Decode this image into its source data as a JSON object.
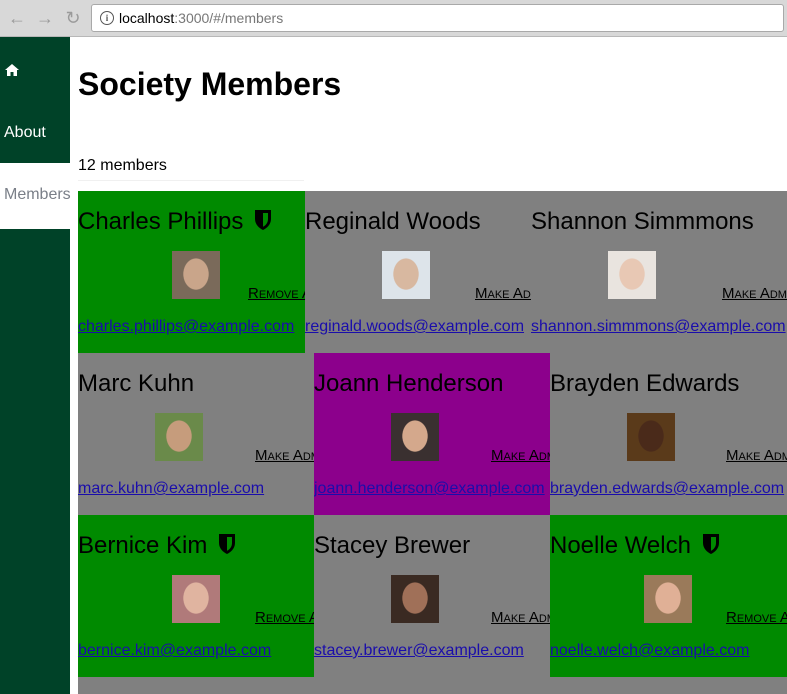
{
  "browser": {
    "url_host": "localhost",
    "url_path": ":3000/#/members"
  },
  "sidebar": {
    "home_icon": "home-icon",
    "about_label": "About",
    "members_label": "Members",
    "bg_color": "#004228"
  },
  "main": {
    "title": "Society Members",
    "member_count": "12 members"
  },
  "members": [
    {
      "name": "Charles Phillips",
      "email": "charles.phillips@example.com",
      "action": "Remove Admin",
      "admin": true
    },
    {
      "name": "Reginald Woods",
      "email": "reginald.woods@example.com",
      "action": "Make Admin",
      "admin": false
    },
    {
      "name": "Shannon Simmmons",
      "email": "shannon.simmmons@example.com",
      "action": "Make Admin",
      "admin": false
    },
    {
      "name": "Marc Kuhn",
      "email": "marc.kuhn@example.com",
      "action": "Make Admin",
      "admin": false
    },
    {
      "name": "Joann Henderson",
      "email": "joann.henderson@example.com",
      "action": "Make Admin",
      "admin": false
    },
    {
      "name": "Brayden Edwards",
      "email": "brayden.edwards@example.com",
      "action": "Make Admin",
      "admin": false
    },
    {
      "name": "Bernice Kim",
      "email": "bernice.kim@example.com",
      "action": "Remove Admin",
      "admin": true
    },
    {
      "name": "Stacey Brewer",
      "email": "stacey.brewer@example.com",
      "action": "Make Admin",
      "admin": false
    },
    {
      "name": "Noelle Welch",
      "email": "noelle.welch@example.com",
      "action": "Remove Admin",
      "admin": true
    }
  ],
  "colors": {
    "admin_card": "#008a00",
    "selected_card": "#8c008c",
    "default_card": "#808080"
  }
}
